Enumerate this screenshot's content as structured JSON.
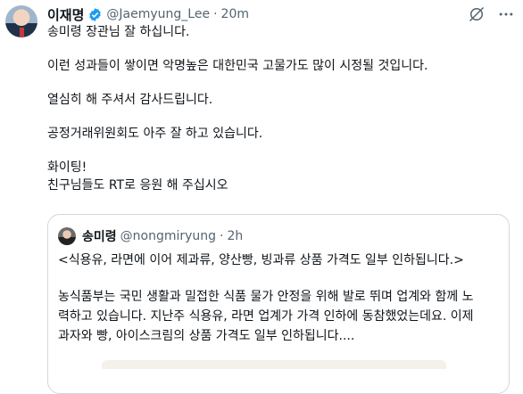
{
  "tweet": {
    "display_name": "이재명",
    "handle": "@Jaemyung_Lee",
    "separator": "·",
    "time": "20m",
    "lines": [
      "송미령 장관님 잘 하십니다.",
      "",
      "이런 성과들이 쌓이면 악명높은 대한민국 고물가도 많이 시정될 것입니다.",
      "",
      "열심히 해 주셔서 감사드립니다.",
      "",
      "공정거래위원회도 아주 잘 하고 있습니다.",
      "",
      "화이팅!",
      "친구님들도 RT로 응원 해 주십시오"
    ]
  },
  "quoted": {
    "display_name": "송미령",
    "handle": "@nongmiryung",
    "separator": "·",
    "time": "2h",
    "lines": [
      "<식용유, 라면에 이어 제과류, 양산빵, 빙과류 상품 가격도 일부 인하됩니다.>",
      "",
      "농식품부는 국민 생활과 밀접한 식품 물가 안정을 위해 발로 뛰며 업계와 함께 노",
      "력하고 있습니다. 지난주 식용유, 라면 업계가 가격 인하에 동참했었는데요. 이제",
      "과자와 빵, 아이스크림의 상품 가격도 일부 인하됩니다...."
    ]
  },
  "icons": {
    "verified": "verified-badge-icon",
    "grok": "grok-icon",
    "more": "more-options-icon"
  },
  "colors": {
    "verified": "#1d9bf0",
    "secondary_text": "#536471",
    "border": "#cfd9de"
  }
}
